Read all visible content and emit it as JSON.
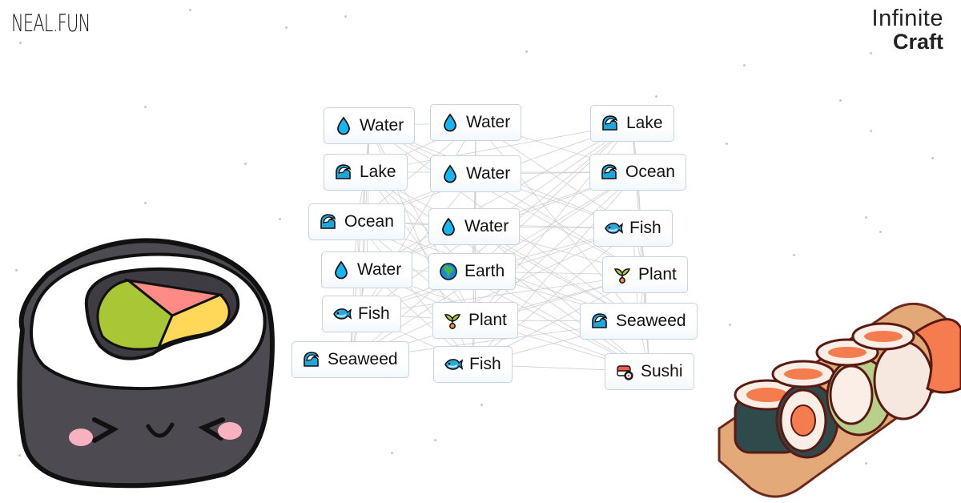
{
  "header": {
    "brand": "NEAL.FUN",
    "app_title_line1": "Infinite",
    "app_title_line2": "Craft"
  },
  "icons": {
    "water": "droplet-icon",
    "lake": "wave-icon",
    "ocean": "wave-icon",
    "seaweed": "wave-icon",
    "fish": "fish-icon",
    "plant": "seedling-icon",
    "earth": "globe-icon",
    "sushi": "sushi-icon"
  },
  "colors": {
    "item_border": "#c5d3e2",
    "droplet": "#16b6f0",
    "wave": "#1ea7d8",
    "line": "#cfcfcf"
  },
  "columns": {
    "left": [
      {
        "label": "Water",
        "icon": "water"
      },
      {
        "label": "Lake",
        "icon": "lake"
      },
      {
        "label": "Ocean",
        "icon": "ocean"
      },
      {
        "label": "Water",
        "icon": "water"
      },
      {
        "label": "Fish",
        "icon": "fish"
      },
      {
        "label": "Seaweed",
        "icon": "seaweed"
      }
    ],
    "middle": [
      {
        "label": "Water",
        "icon": "water"
      },
      {
        "label": "Water",
        "icon": "water"
      },
      {
        "label": "Water",
        "icon": "water"
      },
      {
        "label": "Earth",
        "icon": "earth"
      },
      {
        "label": "Plant",
        "icon": "plant"
      },
      {
        "label": "Fish",
        "icon": "fish"
      }
    ],
    "right": [
      {
        "label": "Lake",
        "icon": "lake"
      },
      {
        "label": "Ocean",
        "icon": "ocean"
      },
      {
        "label": "Fish",
        "icon": "fish"
      },
      {
        "label": "Plant",
        "icon": "plant"
      },
      {
        "label": "Seaweed",
        "icon": "seaweed"
      },
      {
        "label": "Sushi",
        "icon": "sushi"
      }
    ]
  }
}
